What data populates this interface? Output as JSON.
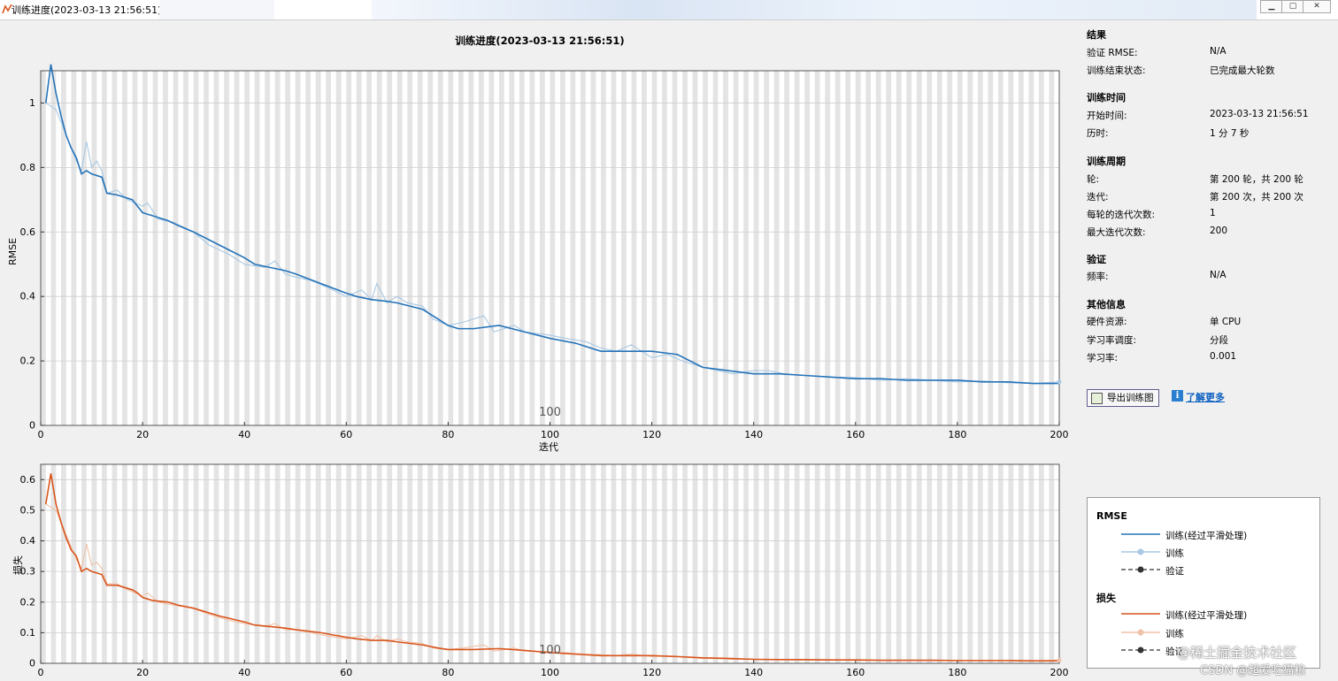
{
  "window": {
    "title": "训练进度(2023-03-13 21:56:51)",
    "controls": [
      "minimize-icon",
      "maximize-icon",
      "close-icon"
    ]
  },
  "plot_title": "训练进度(2023-03-13 21:56:51)",
  "rmse_axis": {
    "ylabel": "RMSE",
    "xlabel": "迭代",
    "epoch_marker": "100"
  },
  "loss_axis": {
    "ylabel": "损失",
    "epoch_marker": "100"
  },
  "info": {
    "results": {
      "title": "结果",
      "val_rmse_label": "验证 RMSE:",
      "val_rmse_value": "N/A",
      "status_label": "训练结束状态:",
      "status_value": "已完成最大轮数"
    },
    "time": {
      "title": "训练时间",
      "start_label": "开始时间:",
      "start_value": "2023-03-13 21:56:51",
      "elapsed_label": "历时:",
      "elapsed_value": "1 分 7 秒"
    },
    "cycle": {
      "title": "训练周期",
      "epoch_label": "轮:",
      "epoch_value": "第 200 轮，共 200 轮",
      "iter_label": "迭代:",
      "iter_value": "第 200 次，共 200 次",
      "iter_per_epoch_label": "每轮的迭代次数:",
      "iter_per_epoch_value": "1",
      "max_iter_label": "最大迭代次数:",
      "max_iter_value": "200"
    },
    "validation": {
      "title": "验证",
      "freq_label": "频率:",
      "freq_value": "N/A"
    },
    "other": {
      "title": "其他信息",
      "hw_label": "硬件资源:",
      "hw_value": "单 CPU",
      "lr_schedule_label": "学习率调度:",
      "lr_schedule_value": "分段",
      "lr_label": "学习率:",
      "lr_value": "0.001"
    }
  },
  "buttons": {
    "export": "导出训练图",
    "learn_more": "了解更多"
  },
  "legend": {
    "rmse_title": "RMSE",
    "loss_title": "损失",
    "smoothed": "训练(经过平滑处理)",
    "train": "训练",
    "validation": "验证"
  },
  "watermark": {
    "line1": "@稀土掘金技术社区",
    "line2": "CSDN @超爱吃猫粮"
  },
  "colors": {
    "rmse_smoothed": "#2573b9",
    "rmse_raw": "#a9c8e3",
    "loss_smoothed": "#d9541b",
    "loss_raw": "#efc2a8",
    "validation": "#333333",
    "epoch_band": "#e4e4e4"
  },
  "chart_data": [
    {
      "type": "line",
      "title": "",
      "xlabel": "迭代",
      "ylabel": "RMSE",
      "xlim": [
        0,
        200
      ],
      "ylim": [
        0,
        1.1
      ],
      "xticks": [
        0,
        20,
        40,
        60,
        80,
        100,
        120,
        140,
        160,
        180,
        200
      ],
      "yticks": [
        0,
        0.2,
        0.4,
        0.6,
        0.8,
        1
      ],
      "grid": true,
      "series": [
        {
          "name": "训练(经过平滑处理)",
          "x": [
            1,
            2,
            3,
            4,
            5,
            6,
            7,
            8,
            9,
            10,
            12,
            13,
            15,
            18,
            19,
            20,
            21,
            22,
            25,
            27,
            30,
            35,
            40,
            42,
            45,
            48,
            50,
            55,
            60,
            62,
            65,
            68,
            70,
            75,
            78,
            80,
            82,
            85,
            90,
            95,
            100,
            105,
            110,
            115,
            120,
            125,
            130,
            135,
            140,
            145,
            150,
            155,
            160,
            165,
            170,
            175,
            180,
            185,
            190,
            195,
            200
          ],
          "y": [
            1.0,
            1.12,
            1.03,
            0.96,
            0.9,
            0.86,
            0.83,
            0.78,
            0.79,
            0.78,
            0.77,
            0.72,
            0.715,
            0.7,
            0.68,
            0.66,
            0.655,
            0.65,
            0.635,
            0.62,
            0.6,
            0.56,
            0.52,
            0.5,
            0.49,
            0.48,
            0.47,
            0.44,
            0.41,
            0.4,
            0.39,
            0.385,
            0.38,
            0.36,
            0.33,
            0.31,
            0.3,
            0.3,
            0.31,
            0.29,
            0.27,
            0.255,
            0.23,
            0.23,
            0.23,
            0.22,
            0.18,
            0.17,
            0.16,
            0.16,
            0.155,
            0.15,
            0.145,
            0.145,
            0.14,
            0.14,
            0.14,
            0.135,
            0.135,
            0.13,
            0.13
          ]
        },
        {
          "name": "训练",
          "x": [
            1,
            3,
            5,
            7,
            8,
            9,
            10,
            11,
            12,
            13,
            15,
            17,
            20,
            21,
            23,
            26,
            30,
            33,
            37,
            40,
            44,
            46,
            48,
            50,
            53,
            56,
            60,
            63,
            65,
            66,
            68,
            70,
            72,
            75,
            77,
            80,
            83,
            85,
            87,
            89,
            91,
            93,
            95,
            100,
            103,
            107,
            110,
            113,
            116,
            120,
            123,
            126,
            130,
            133,
            136,
            140,
            143,
            146,
            150,
            155,
            160,
            165,
            170,
            175,
            180,
            185,
            190,
            195,
            200
          ],
          "y": [
            1.0,
            0.98,
            0.9,
            0.82,
            0.79,
            0.88,
            0.8,
            0.82,
            0.79,
            0.72,
            0.73,
            0.7,
            0.68,
            0.69,
            0.64,
            0.63,
            0.6,
            0.56,
            0.53,
            0.5,
            0.49,
            0.51,
            0.47,
            0.46,
            0.45,
            0.43,
            0.4,
            0.42,
            0.39,
            0.44,
            0.38,
            0.4,
            0.38,
            0.37,
            0.33,
            0.31,
            0.32,
            0.33,
            0.34,
            0.29,
            0.3,
            0.31,
            0.29,
            0.28,
            0.27,
            0.26,
            0.24,
            0.23,
            0.25,
            0.21,
            0.22,
            0.2,
            0.18,
            0.17,
            0.16,
            0.17,
            0.17,
            0.16,
            0.155,
            0.15,
            0.148,
            0.14,
            0.145,
            0.14,
            0.135,
            0.138,
            0.132,
            0.13,
            0.135
          ]
        }
      ]
    },
    {
      "type": "line",
      "title": "",
      "xlabel": "",
      "ylabel": "损失",
      "xlim": [
        0,
        200
      ],
      "ylim": [
        0,
        0.65
      ],
      "xticks": [
        0,
        20,
        40,
        60,
        80,
        100,
        120,
        140,
        160,
        180,
        200
      ],
      "yticks": [
        0,
        0.1,
        0.2,
        0.3,
        0.4,
        0.5,
        0.6
      ],
      "grid": true,
      "series": [
        {
          "name": "训练(经过平滑处理)",
          "x": [
            1,
            2,
            3,
            4,
            5,
            6,
            7,
            8,
            9,
            10,
            12,
            13,
            15,
            18,
            19,
            20,
            21,
            22,
            25,
            27,
            30,
            35,
            40,
            42,
            45,
            48,
            50,
            55,
            60,
            62,
            65,
            68,
            70,
            75,
            78,
            80,
            82,
            85,
            90,
            95,
            100,
            105,
            110,
            115,
            120,
            125,
            130,
            135,
            140,
            145,
            150,
            155,
            160,
            165,
            170,
            175,
            180,
            185,
            190,
            195,
            200
          ],
          "y": [
            0.52,
            0.62,
            0.52,
            0.46,
            0.41,
            0.37,
            0.35,
            0.3,
            0.31,
            0.3,
            0.29,
            0.255,
            0.255,
            0.24,
            0.23,
            0.215,
            0.21,
            0.205,
            0.2,
            0.19,
            0.18,
            0.155,
            0.135,
            0.125,
            0.12,
            0.115,
            0.11,
            0.1,
            0.085,
            0.08,
            0.075,
            0.075,
            0.07,
            0.06,
            0.05,
            0.045,
            0.045,
            0.045,
            0.048,
            0.042,
            0.035,
            0.03,
            0.025,
            0.025,
            0.025,
            0.022,
            0.018,
            0.016,
            0.013,
            0.012,
            0.012,
            0.011,
            0.011,
            0.01,
            0.01,
            0.01,
            0.009,
            0.009,
            0.009,
            0.008,
            0.008
          ]
        },
        {
          "name": "训练",
          "x": [
            1,
            3,
            5,
            7,
            8,
            9,
            10,
            11,
            12,
            13,
            15,
            17,
            20,
            21,
            23,
            26,
            30,
            33,
            37,
            40,
            44,
            46,
            48,
            50,
            53,
            56,
            60,
            63,
            65,
            66,
            68,
            70,
            72,
            75,
            77,
            80,
            83,
            85,
            87,
            89,
            91,
            93,
            95,
            100,
            103,
            107,
            110,
            113,
            116,
            120,
            123,
            126,
            130,
            133,
            136,
            140,
            143,
            146,
            150,
            155,
            160,
            165,
            170,
            175,
            180,
            185,
            190,
            195,
            200
          ],
          "y": [
            0.52,
            0.5,
            0.42,
            0.34,
            0.31,
            0.39,
            0.32,
            0.33,
            0.31,
            0.26,
            0.26,
            0.24,
            0.22,
            0.23,
            0.2,
            0.19,
            0.18,
            0.16,
            0.14,
            0.13,
            0.12,
            0.13,
            0.11,
            0.11,
            0.1,
            0.09,
            0.08,
            0.09,
            0.075,
            0.09,
            0.07,
            0.08,
            0.07,
            0.065,
            0.05,
            0.045,
            0.05,
            0.055,
            0.06,
            0.04,
            0.045,
            0.05,
            0.04,
            0.038,
            0.035,
            0.03,
            0.028,
            0.025,
            0.03,
            0.022,
            0.024,
            0.02,
            0.016,
            0.015,
            0.013,
            0.014,
            0.013,
            0.012,
            0.011,
            0.011,
            0.01,
            0.01,
            0.01,
            0.009,
            0.009,
            0.009,
            0.008,
            0.008,
            0.01
          ]
        }
      ]
    }
  ]
}
